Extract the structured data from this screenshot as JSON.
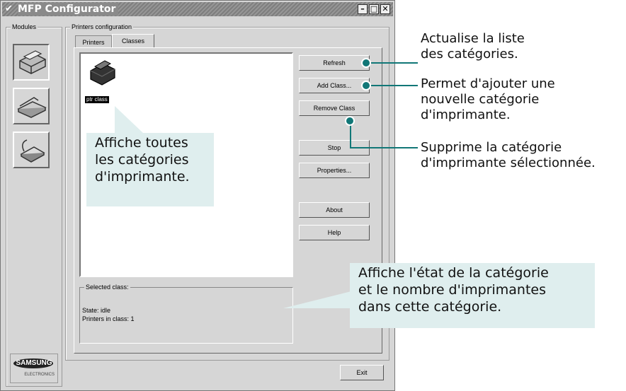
{
  "window": {
    "title": "MFP Configurator",
    "menu_glyph": "✔",
    "controls": {
      "minimize": "–",
      "maximize": "□",
      "close": "✕"
    }
  },
  "modules": {
    "label": "Modules",
    "items": [
      {
        "name": "printer-module",
        "icon": "printer-icon"
      },
      {
        "name": "scanner-module",
        "icon": "scanner-icon"
      },
      {
        "name": "port-module",
        "icon": "port-icon"
      }
    ]
  },
  "printers_config": {
    "label": "Printers configuration",
    "tabs": [
      {
        "label": "Printers",
        "active": false
      },
      {
        "label": "Classes",
        "active": true
      }
    ],
    "class_list": [
      {
        "name": "ptr class",
        "selected": true,
        "icon": "printer-class-icon"
      }
    ],
    "buttons": {
      "refresh": "Refresh",
      "add_class": "Add Class...",
      "remove_class": "Remove Class",
      "stop": "Stop",
      "properties": "Properties...",
      "about": "About",
      "help": "Help"
    },
    "selected_class": {
      "label": "Selected class:",
      "state": "State: idle",
      "printers_in_class": "Printers in class: 1"
    }
  },
  "exit_button": "Exit",
  "brand": {
    "logo_text": "SAMSUNG",
    "sub_text": "ELECTRONICS"
  },
  "annotations": {
    "refresh_note": [
      "Actualise la liste",
      "des catégories."
    ],
    "add_note": [
      "Permet d'ajouter une",
      "nouvelle catégorie",
      "d'imprimante."
    ],
    "remove_note": [
      "Supprime la catégorie",
      "d'imprimante sélectionnée."
    ],
    "list_note": [
      "Affiche toutes",
      "les catégories",
      "d'imprimante."
    ],
    "status_note": [
      "Affiche l'état de la catégorie",
      "et le nombre d'imprimantes",
      "dans cette catégorie."
    ]
  },
  "colors": {
    "accent": "#117777",
    "callout_bg": "#dfeeee",
    "window_bg": "#d6d6d6"
  }
}
